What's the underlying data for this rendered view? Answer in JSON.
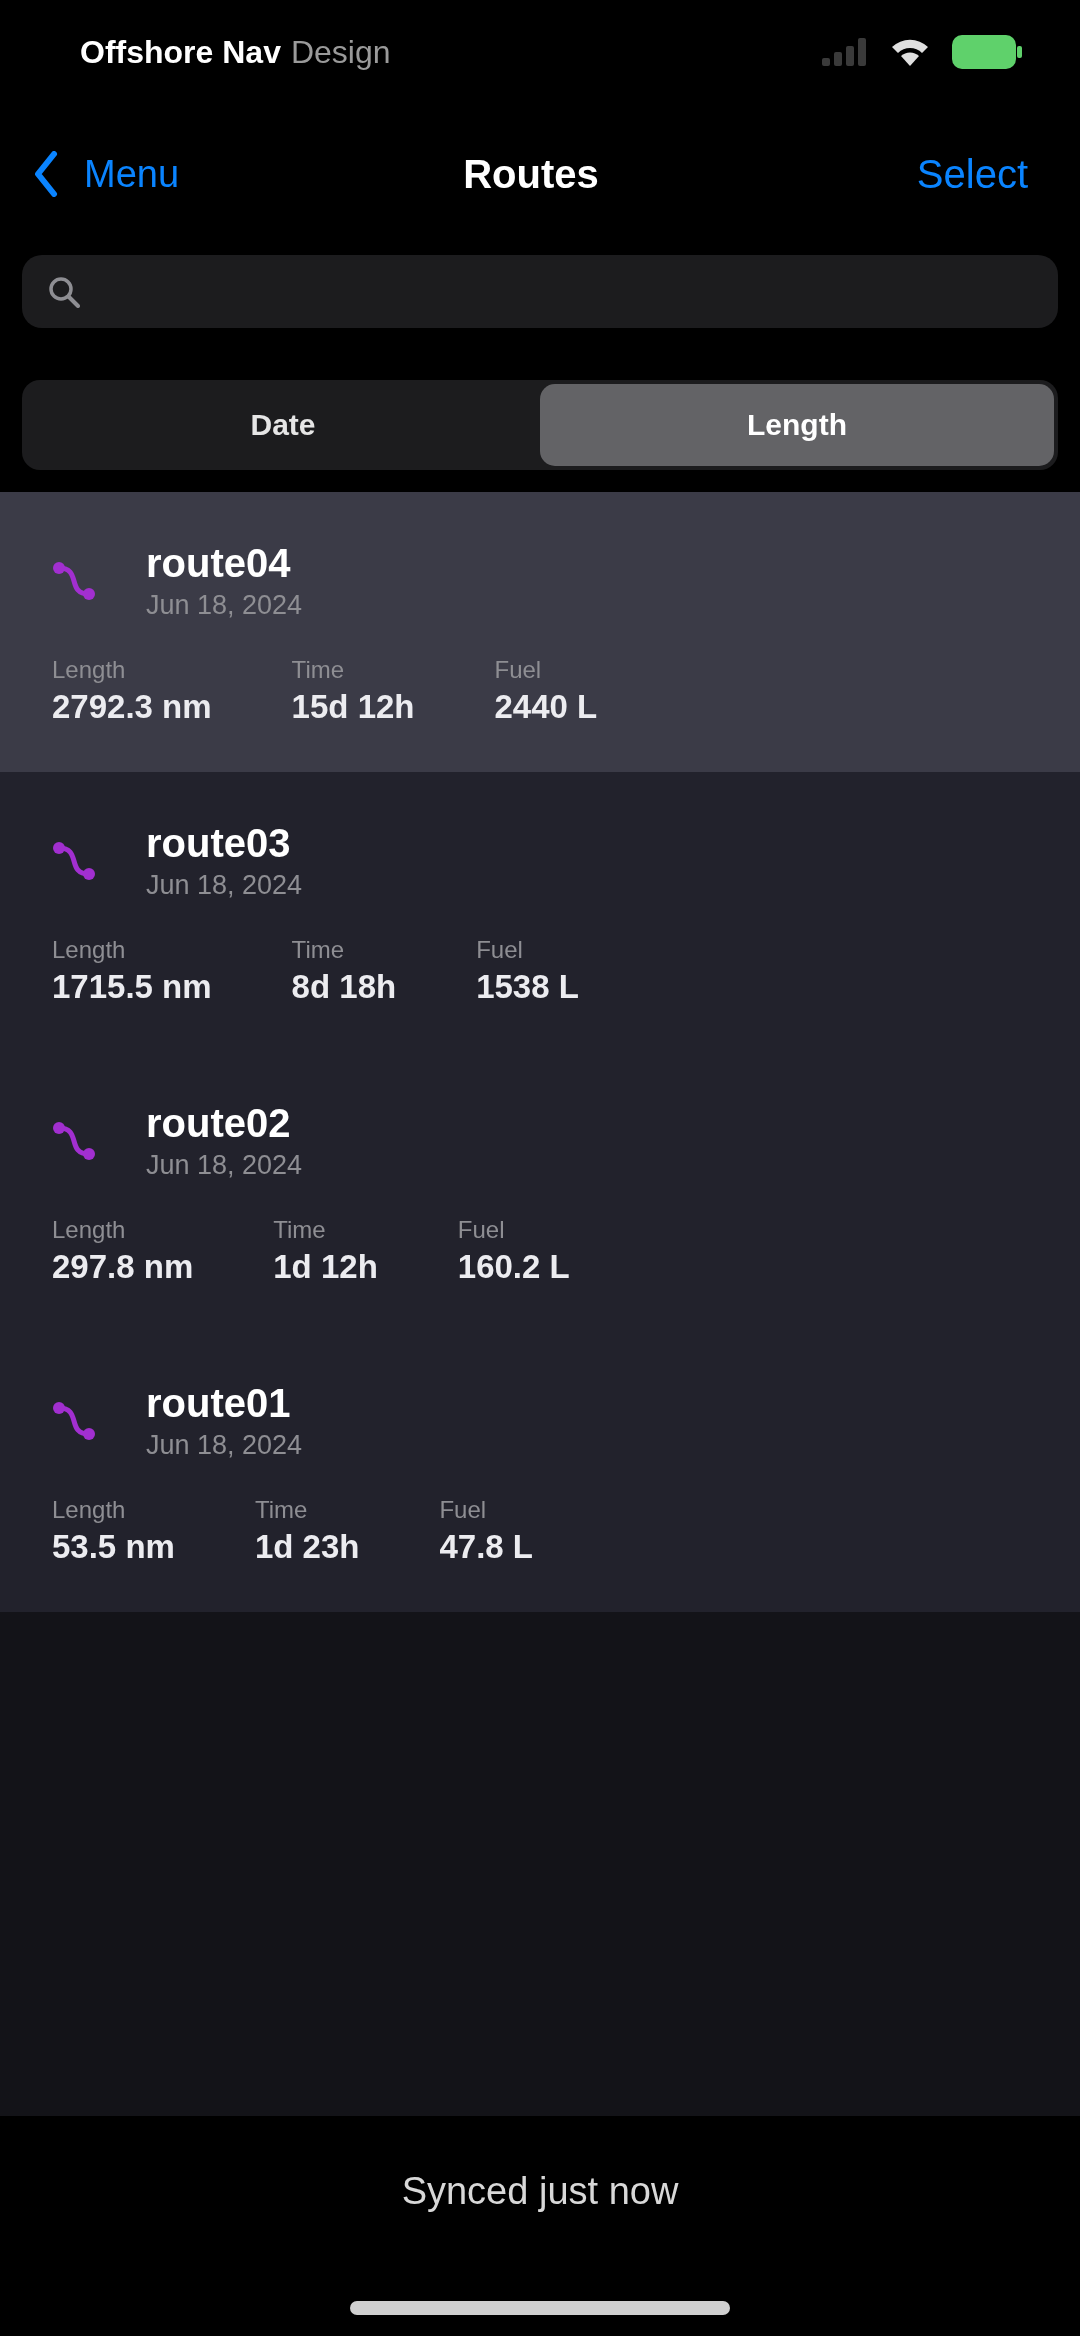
{
  "status_bar": {
    "label": "Offshore Nav",
    "sublabel": "Design"
  },
  "nav": {
    "back": "Menu",
    "title": "Routes",
    "action": "Select"
  },
  "segments": [
    {
      "label": "Date",
      "selected": false
    },
    {
      "label": "Length",
      "selected": true
    }
  ],
  "routes": [
    {
      "name": "route04",
      "date": "Jun 18, 2024",
      "selected": true,
      "stats": [
        {
          "label": "Length",
          "value": "2792.3 nm"
        },
        {
          "label": "Time",
          "value": "15d 12h"
        },
        {
          "label": "Fuel",
          "value": "2440 L"
        }
      ]
    },
    {
      "name": "route03",
      "date": "Jun 18, 2024",
      "selected": false,
      "stats": [
        {
          "label": "Length",
          "value": "1715.5 nm"
        },
        {
          "label": "Time",
          "value": "8d 18h"
        },
        {
          "label": "Fuel",
          "value": "1538 L"
        }
      ]
    },
    {
      "name": "route02",
      "date": "Jun 18, 2024",
      "selected": false,
      "stats": [
        {
          "label": "Length",
          "value": "297.8 nm"
        },
        {
          "label": "Time",
          "value": "1d 12h"
        },
        {
          "label": "Fuel",
          "value": "160.2 L"
        }
      ]
    },
    {
      "name": "route01",
      "date": "Jun 18, 2024",
      "selected": false,
      "stats": [
        {
          "label": "Length",
          "value": "53.5 nm"
        },
        {
          "label": "Time",
          "value": "1d 23h"
        },
        {
          "label": "Fuel",
          "value": "47.8 L"
        }
      ]
    }
  ],
  "footer": {
    "status": "Synced just now"
  }
}
